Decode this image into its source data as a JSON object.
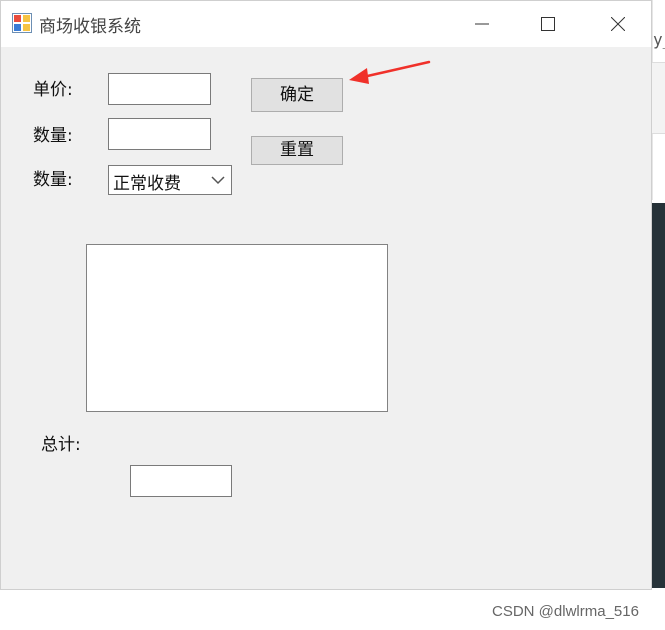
{
  "window": {
    "title": "商场收银系统",
    "title_icon": "winforms-app-icon",
    "controls": [
      "minimize-icon",
      "maximize-icon",
      "close-icon"
    ]
  },
  "form": {
    "unit_price_label": "单价:",
    "quantity_label": "数量:",
    "mode_label": "数量:",
    "unit_price_value": "",
    "quantity_value": "",
    "mode_selected": "正常收费",
    "confirm_label": "确定",
    "reset_label": "重置",
    "list_items": [],
    "total_label": "总计:",
    "total_value": ""
  },
  "annotation": {
    "arrow_color": "#f0312a"
  },
  "background": {
    "peek_text": "y_"
  },
  "watermark": "CSDN @dlwlrma_516"
}
